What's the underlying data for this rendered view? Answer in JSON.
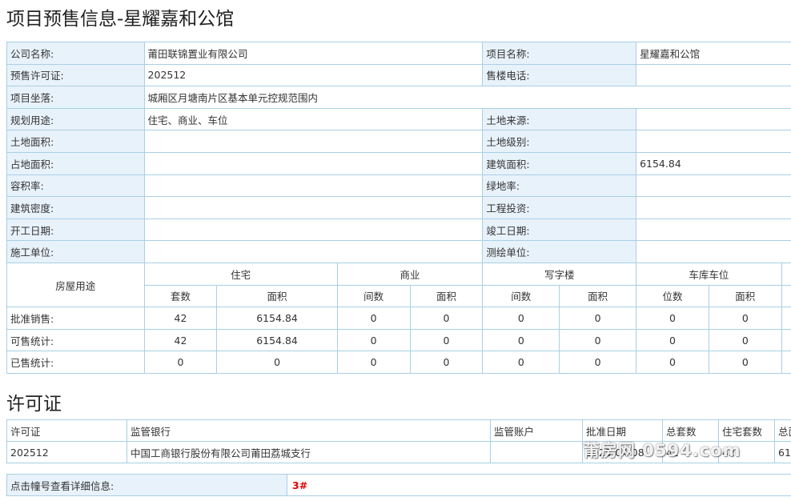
{
  "title": "项目预售信息-星耀嘉和公馆",
  "info": {
    "company_label": "公司名称:",
    "company_value": "莆田联锦置业有限公司",
    "project_label": "项目名称:",
    "project_value": "星耀嘉和公馆",
    "presale_label": "预售许可证:",
    "presale_value": "202512",
    "phone_label": "售楼电话:",
    "phone_value": "",
    "location_label": "项目坐落:",
    "location_value": "城厢区月塘南片区基本单元控规范围内",
    "usage_label": "规划用途:",
    "usage_value": "住宅、商业、车位",
    "land_source_label": "土地来源:",
    "land_source_value": "",
    "land_area_label": "土地面积:",
    "land_area_value": "",
    "land_level_label": "土地级别:",
    "land_level_value": "",
    "cover_area_label": "占地面积:",
    "cover_area_value": "",
    "build_area_label": "建筑面积:",
    "build_area_value": "6154.84",
    "far_label": "容积率:",
    "far_value": "",
    "green_label": "绿地率:",
    "green_value": "",
    "density_label": "建筑密度:",
    "density_value": "",
    "investment_label": "工程投资:",
    "investment_value": "",
    "start_label": "开工日期:",
    "start_value": "",
    "finish_label": "竣工日期:",
    "finish_value": "",
    "builder_label": "施工单位:",
    "builder_value": "",
    "surveyor_label": "测绘单位:",
    "surveyor_value": ""
  },
  "housing": {
    "use_label": "房屋用途",
    "groups": [
      "住宅",
      "商业",
      "写字楼",
      "车库车位"
    ],
    "subheaders": [
      "套数",
      "面积",
      "间数",
      "面积",
      "间数",
      "面积",
      "位数",
      "面积"
    ],
    "rows": [
      {
        "label": "批准销售:",
        "values": [
          "42",
          "6154.84",
          "0",
          "0",
          "0",
          "0",
          "0",
          "0"
        ]
      },
      {
        "label": "可售统计:",
        "values": [
          "42",
          "6154.84",
          "0",
          "0",
          "0",
          "0",
          "0",
          "0"
        ]
      },
      {
        "label": "已售统计:",
        "values": [
          "0",
          "0",
          "0",
          "0",
          "0",
          "0",
          "0",
          "0"
        ]
      }
    ]
  },
  "permit_section": {
    "title": "许可证",
    "headers": [
      "许可证",
      "监管银行",
      "监管账户",
      "批准日期",
      "总套数",
      "住宅套数",
      "总面"
    ],
    "row": [
      "202512",
      "中国工商银行股份有限公司莆田荔城支行",
      "",
      "2025-04-08",
      "42",
      "42",
      "61"
    ]
  },
  "detail": {
    "label": "点击幢号查看详细信息:",
    "building": "3#"
  },
  "watermark": "莆房网 0594.com"
}
